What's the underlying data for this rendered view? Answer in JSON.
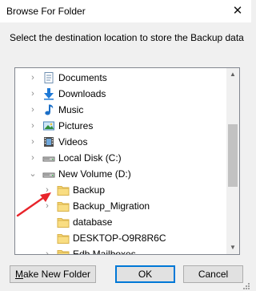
{
  "window": {
    "title": "Browse For Folder",
    "close_glyph": "✕"
  },
  "instruction": "Select the destination location to store the Backup data",
  "tree": {
    "items": [
      {
        "label": "Documents",
        "icon": "documents-icon",
        "expander": "collapsed"
      },
      {
        "label": "Downloads",
        "icon": "downloads-icon",
        "expander": "collapsed"
      },
      {
        "label": "Music",
        "icon": "music-icon",
        "expander": "collapsed"
      },
      {
        "label": "Pictures",
        "icon": "pictures-icon",
        "expander": "collapsed"
      },
      {
        "label": "Videos",
        "icon": "videos-icon",
        "expander": "collapsed"
      },
      {
        "label": "Local Disk (C:)",
        "icon": "drive-icon",
        "expander": "collapsed"
      },
      {
        "label": "New Volume (D:)",
        "icon": "drive-icon",
        "expander": "expanded"
      },
      {
        "label": "Backup",
        "icon": "folder-icon",
        "expander": "collapsed"
      },
      {
        "label": "Backup_Migration",
        "icon": "folder-icon",
        "expander": "collapsed"
      },
      {
        "label": "database",
        "icon": "folder-icon",
        "expander": "none"
      },
      {
        "label": "DESKTOP-O9R8R6C",
        "icon": "folder-icon",
        "expander": "none"
      },
      {
        "label": "Edb Mailboxes",
        "icon": "folder-icon",
        "expander": "collapsed"
      }
    ]
  },
  "buttons": {
    "make_new_folder_mnemonic": "M",
    "make_new_folder_rest": "ake New Folder",
    "ok": "OK",
    "cancel": "Cancel"
  },
  "colors": {
    "annotation_arrow": "#e8242a",
    "folder": "#f7d774",
    "ok_border": "#0078d7"
  }
}
